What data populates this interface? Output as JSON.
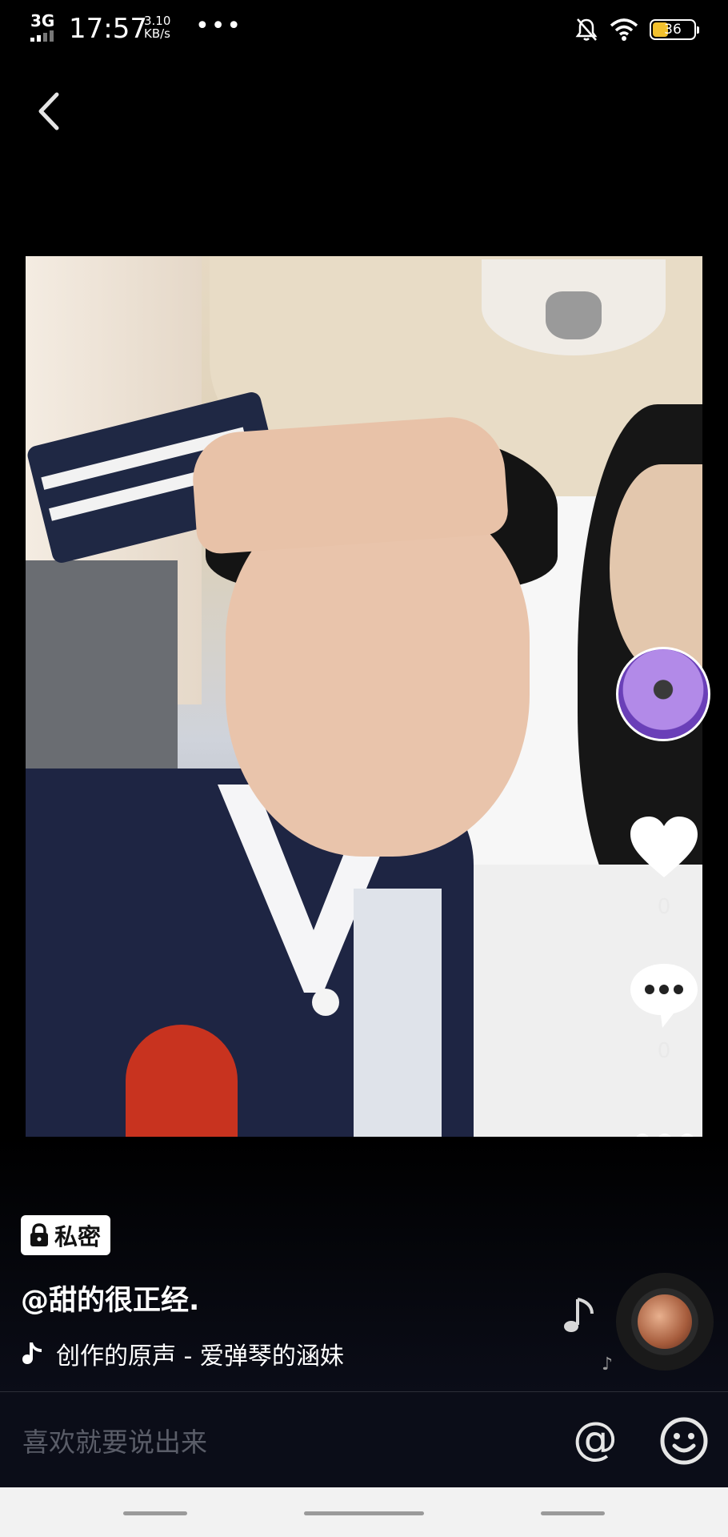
{
  "status_bar": {
    "network": "3G",
    "time": "17:57",
    "speed_value": "3.10",
    "speed_unit": "KB/s",
    "more_dots": "•••",
    "battery_level": "36",
    "battery_color": "#f2c12e"
  },
  "post": {
    "privacy_label": "私密",
    "author": "@甜的很正经.",
    "music": "创作的原声 - 爱弹琴的涵妹",
    "like_count": "0",
    "comment_count": "0"
  },
  "comment_bar": {
    "placeholder": "喜欢就要说出来",
    "at_symbol": "@"
  },
  "icons": [
    "back-icon",
    "bell-off-icon",
    "wifi-icon",
    "battery-icon",
    "heart-icon",
    "comment-icon",
    "more-icon",
    "lock-icon",
    "tiktok-music-icon",
    "music-note-icon",
    "emoji-icon"
  ]
}
